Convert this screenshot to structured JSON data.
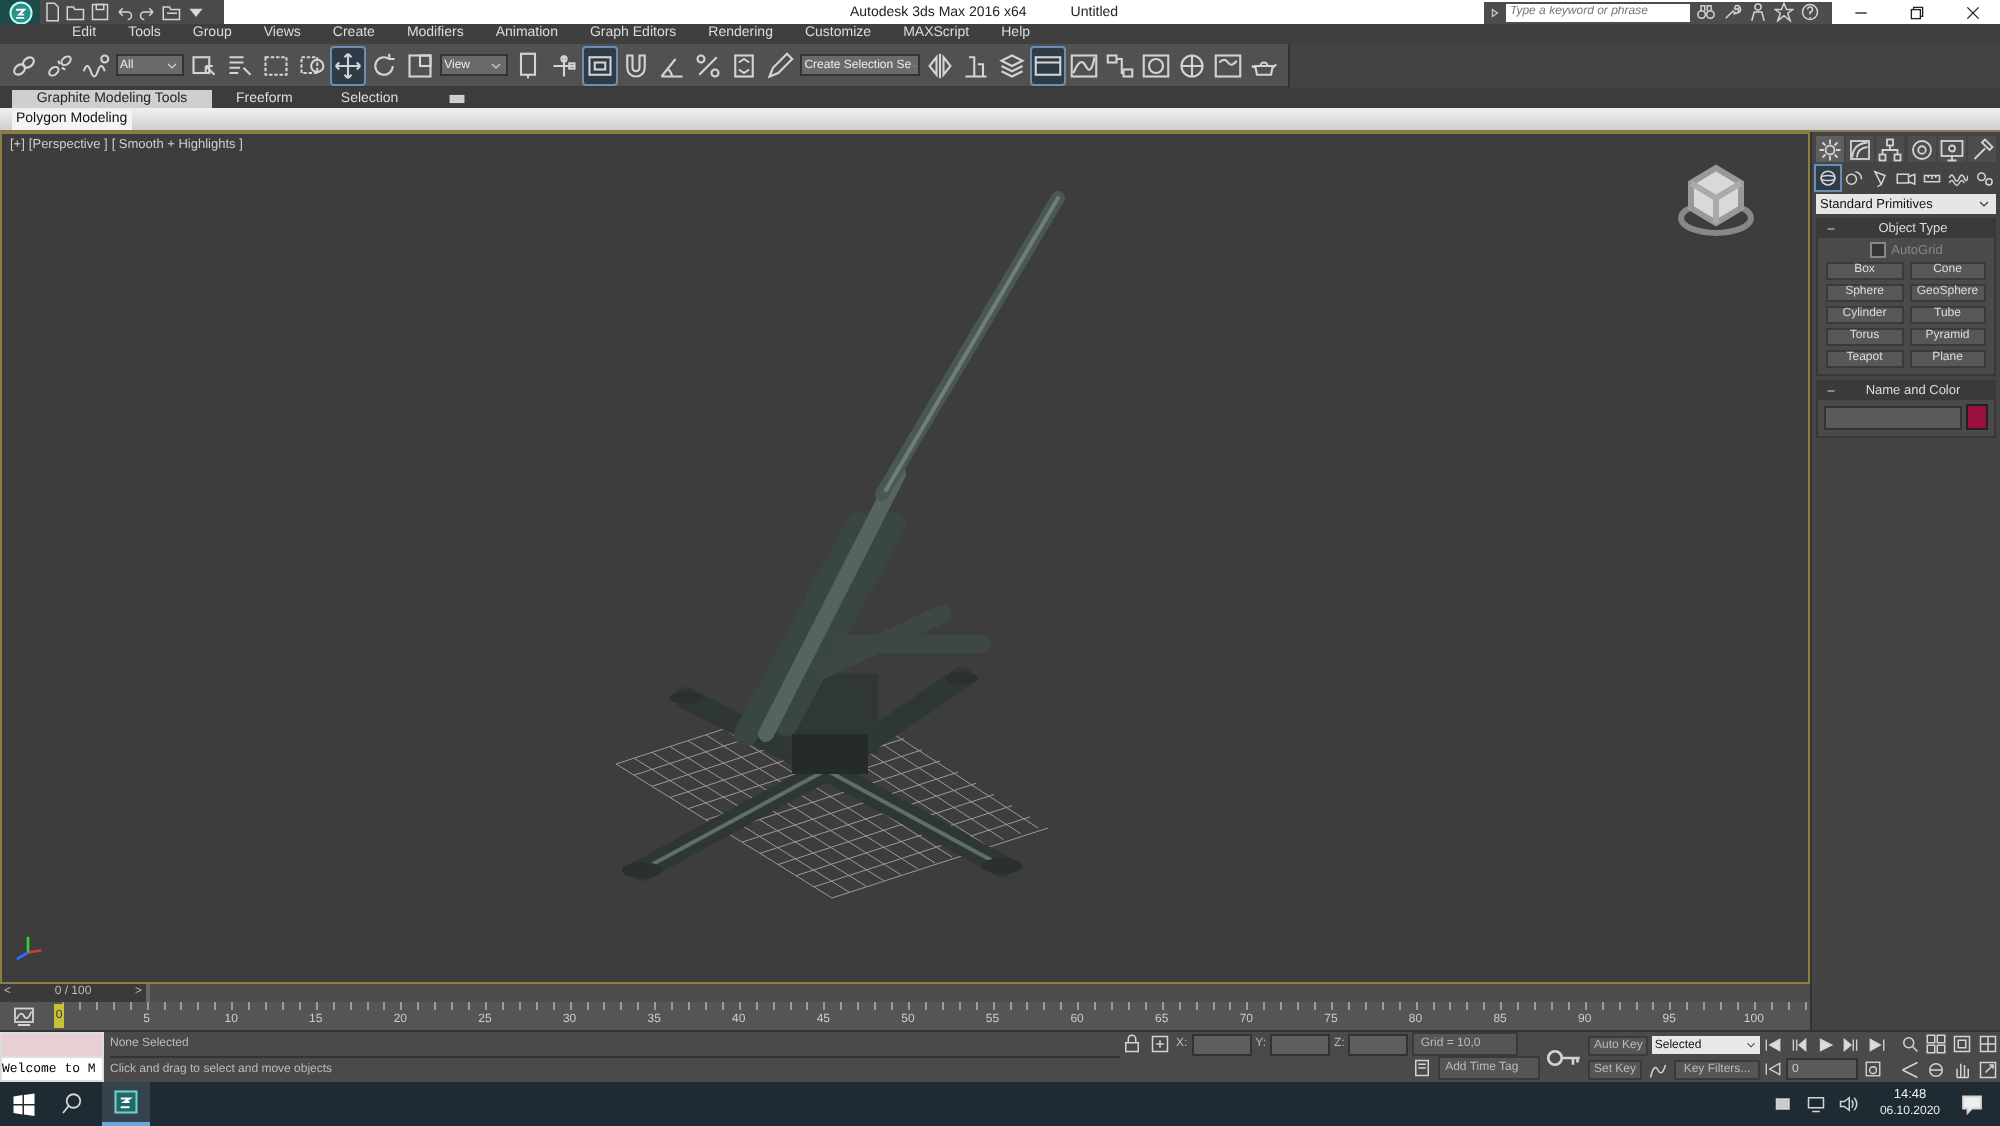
{
  "title_bar": {
    "title": "Autodesk 3ds Max 2016 x64",
    "document": "Untitled",
    "search": {
      "placeholder": "Type a keyword or phrase"
    }
  },
  "menu": [
    "Edit",
    "Tools",
    "Group",
    "Views",
    "Create",
    "Modifiers",
    "Animation",
    "Graph Editors",
    "Rendering",
    "Customize",
    "MAXScript",
    "Help"
  ],
  "toolbar": [
    {
      "kind": "tool",
      "selected": false
    },
    {
      "kind": "tool",
      "selected": false
    },
    {
      "kind": "tool",
      "selected": false
    },
    {
      "kind": "dropdown",
      "value": "All"
    },
    {
      "kind": "tool",
      "selected": false
    },
    {
      "kind": "tool",
      "selected": false
    },
    {
      "kind": "tool",
      "selected": false
    },
    {
      "kind": "tool",
      "selected": false
    },
    {
      "kind": "tool",
      "selected": true
    },
    {
      "kind": "tool",
      "selected": false
    },
    {
      "kind": "tool",
      "selected": false
    },
    {
      "kind": "dropdown",
      "value": "View"
    },
    {
      "kind": "tool",
      "selected": false
    },
    {
      "kind": "tool",
      "selected": false
    },
    {
      "kind": "tool",
      "selected": true
    },
    {
      "kind": "tool",
      "selected": false
    },
    {
      "kind": "tool",
      "selected": false
    },
    {
      "kind": "tool",
      "selected": false
    },
    {
      "kind": "tool",
      "selected": false
    },
    {
      "kind": "tool",
      "selected": false
    },
    {
      "kind": "dropdown",
      "value": "Create Selection Se"
    },
    {
      "kind": "tool",
      "selected": false
    },
    {
      "kind": "tool",
      "selected": false
    },
    {
      "kind": "tool",
      "selected": false
    },
    {
      "kind": "tool",
      "selected": true
    },
    {
      "kind": "tool",
      "selected": false
    },
    {
      "kind": "tool",
      "selected": false
    },
    {
      "kind": "tool",
      "selected": false
    },
    {
      "kind": "tool",
      "selected": false
    },
    {
      "kind": "tool",
      "selected": false
    },
    {
      "kind": "tool",
      "selected": false
    }
  ],
  "ribbon": {
    "tabs": [
      {
        "label": "Graphite Modeling Tools",
        "selected": true
      },
      {
        "label": "Freeform",
        "selected": false
      },
      {
        "label": "Selection",
        "selected": false
      }
    ],
    "panel": "Polygon Modeling"
  },
  "viewport": {
    "labels": [
      "[+]",
      "[Perspective ]",
      "[ Smooth + Highlights ]"
    ]
  },
  "command_panel": {
    "tabs": [
      {
        "selected": true
      },
      {
        "selected": false
      },
      {
        "selected": false
      },
      {
        "selected": false
      },
      {
        "selected": false
      },
      {
        "selected": false
      }
    ],
    "categories": [
      {
        "selected": true
      },
      {
        "selected": false
      },
      {
        "selected": false
      },
      {
        "selected": false
      },
      {
        "selected": false
      },
      {
        "selected": false
      },
      {
        "selected": false
      }
    ],
    "dropdown": "Standard Primitives",
    "object_type": {
      "title": "Object Type",
      "autogrid": {
        "label": "AutoGrid",
        "checked": false
      },
      "buttons": [
        "Box",
        "Cone",
        "Sphere",
        "GeoSphere",
        "Cylinder",
        "Tube",
        "Torus",
        "Pyramid",
        "Teapot",
        "Plane"
      ]
    },
    "name_and_color": {
      "title": "Name and Color",
      "color": "#9a0f3c"
    }
  },
  "time_slider": {
    "label": "0 / 100",
    "prev": "<",
    "next": ">"
  },
  "track_bar": {
    "marker": "0",
    "ticks": [
      "5",
      "10",
      "15",
      "20",
      "25",
      "30",
      "35",
      "40",
      "45",
      "50",
      "55",
      "60",
      "65",
      "70",
      "75",
      "80",
      "85",
      "90",
      "95",
      "100"
    ]
  },
  "status": {
    "listener_output": "Welcome to M",
    "selection": "None Selected",
    "prompt": "Click and drag to select and move objects",
    "coords": [
      "X:",
      "Y:",
      "Z:"
    ],
    "grid": "Grid = 10,0",
    "time_tag": "Add Time Tag",
    "auto_key": "Auto Key",
    "key_mode": "Selected",
    "set_key": "Set Key",
    "key_filters": "Key Filters...",
    "frame": "0"
  },
  "taskbar": {
    "time": "14:48",
    "date": "06.10.2020"
  }
}
